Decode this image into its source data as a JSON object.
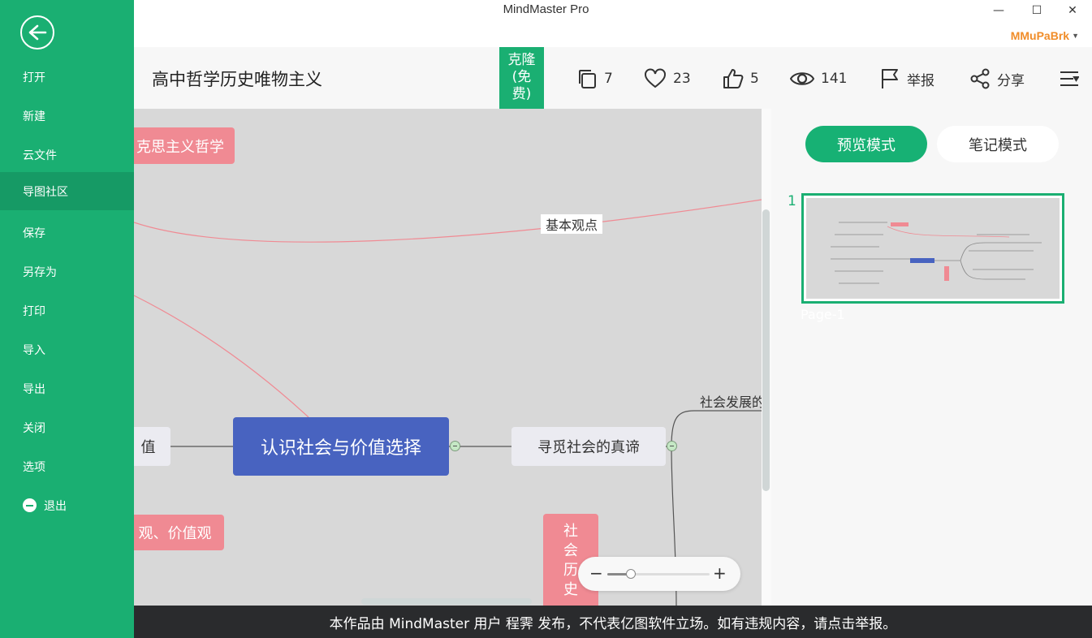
{
  "app": {
    "title": "MindMaster Pro",
    "username": "MMuPaBrk",
    "minimize": "—",
    "maximize": "☐",
    "close": "✕"
  },
  "sidebar": {
    "items": [
      {
        "label": "打开"
      },
      {
        "label": "新建"
      },
      {
        "label": "云文件"
      },
      {
        "label": "导图社区"
      },
      {
        "label": "保存"
      },
      {
        "label": "另存为"
      },
      {
        "label": "打印"
      },
      {
        "label": "导入"
      },
      {
        "label": "导出"
      },
      {
        "label": "关闭"
      },
      {
        "label": "选项"
      },
      {
        "label": "退出"
      }
    ],
    "active_index": 3
  },
  "header": {
    "doc_title": "高中哲学历史唯物主义",
    "clone": {
      "line1": "克隆",
      "line2": "(免",
      "line3": "费)"
    },
    "copies": "7",
    "likes": "23",
    "thumbs": "5",
    "views": "141",
    "report": "举报",
    "share": "分享"
  },
  "canvas": {
    "nodes": {
      "top_pink": "克思主义哲学",
      "basic_view": "基本观点",
      "left_gray": "值",
      "center": "认识社会与价值选择",
      "right_gray": "寻觅社会的真谛",
      "social_dev": "社会发展的",
      "bottom_pink": "观、价值观",
      "vertical_pink": [
        "社",
        "会",
        "历",
        "史"
      ]
    },
    "zoom_level": 0.23
  },
  "right_panel": {
    "preview_mode": "预览模式",
    "note_mode": "笔记模式",
    "page_number": "1",
    "page_label": "Page-1"
  },
  "footer": {
    "notice": "本作品由 MindMaster 用户 程霁 发布，不代表亿图软件立场。如有违规内容，请点击举报。"
  },
  "colors": {
    "brand_green": "#1aaf72",
    "center_node": "#4863c0",
    "pink_node": "#f08a93",
    "username": "#f08c28"
  }
}
